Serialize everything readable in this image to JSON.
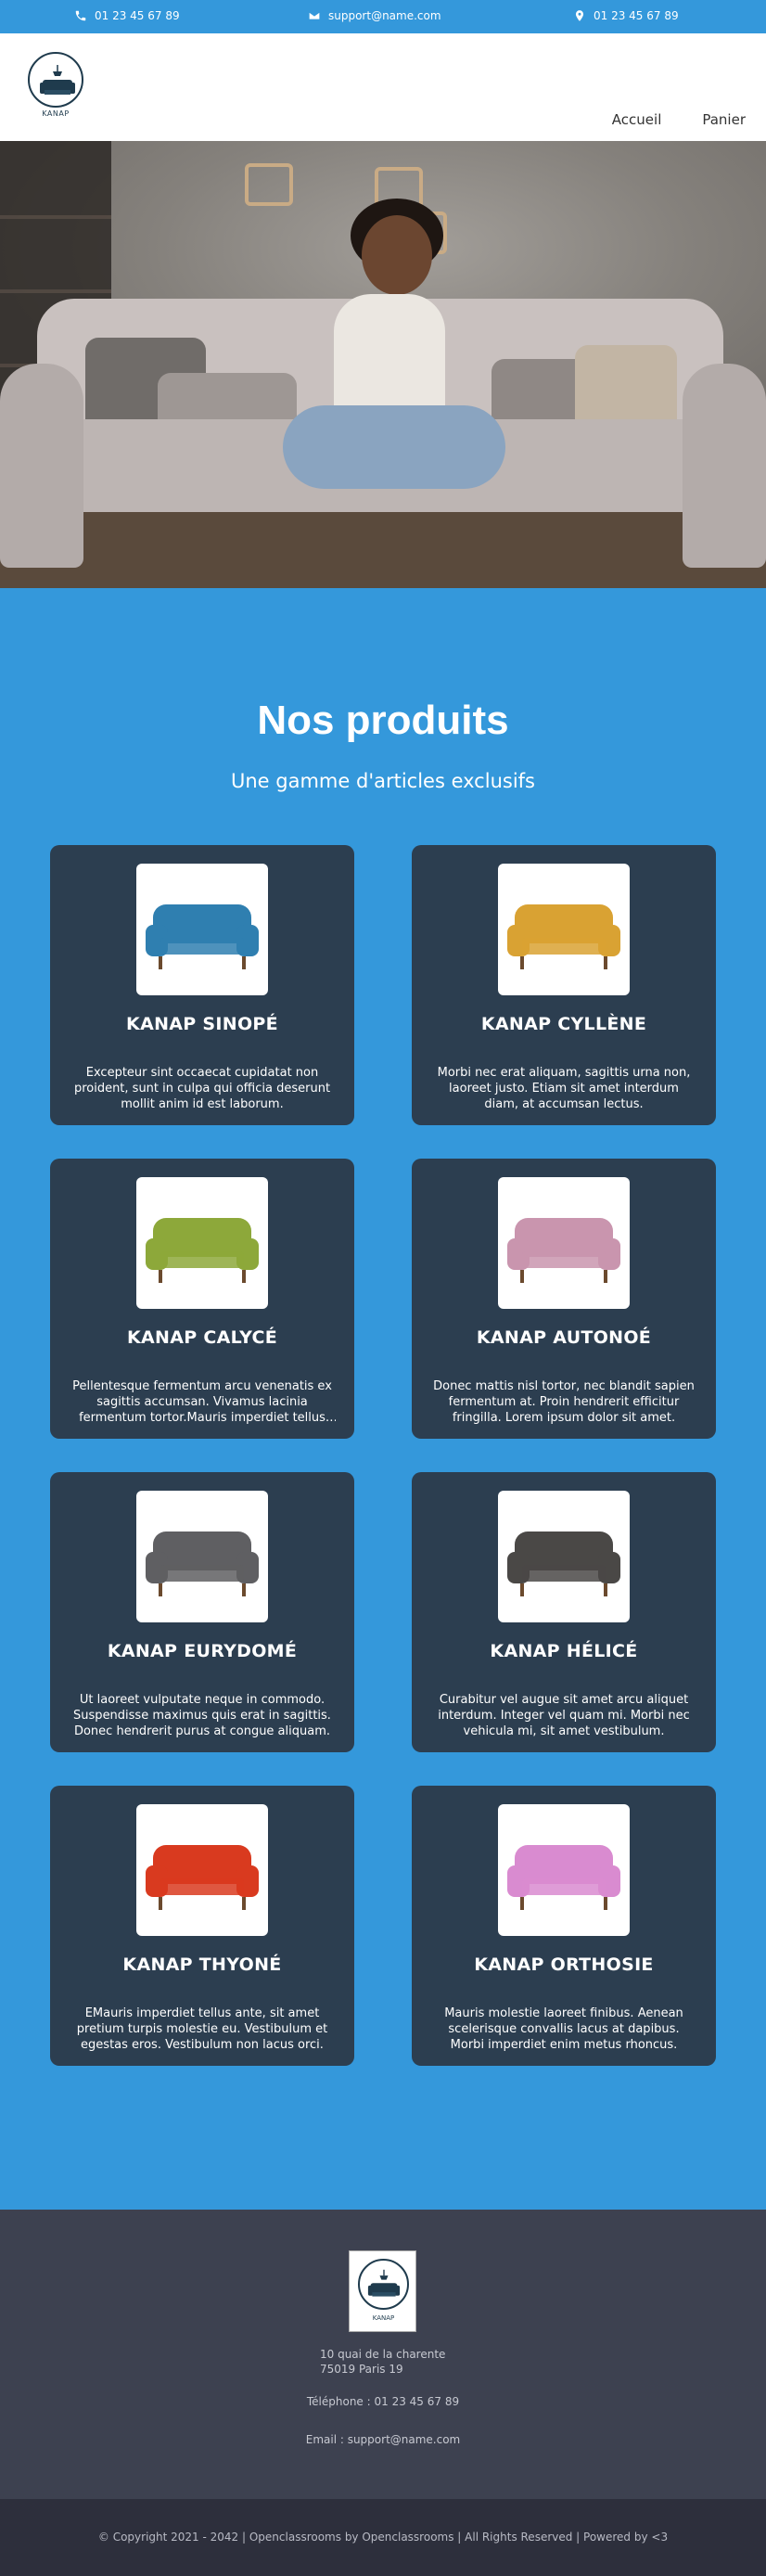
{
  "topbar": {
    "phone_1": "01 23 45 67 89",
    "email": "support@name.com",
    "phone_2": "01 23 45 67 89"
  },
  "header": {
    "logo_text": "KANAP",
    "nav": [
      {
        "label": "Accueil"
      },
      {
        "label": "Panier"
      }
    ]
  },
  "products": {
    "title": "Nos produits",
    "subtitle": "Une gamme d'articles exclusifs",
    "items": [
      {
        "name": "KANAP SINOPÉ",
        "color": "#2f7fb0",
        "description": "Excepteur sint occaecat cupidatat non proident, sunt in culpa qui officia deserunt mollit anim id est laborum."
      },
      {
        "name": "KANAP CYLLÈNE",
        "color": "#d9a233",
        "description": "Morbi nec erat aliquam, sagittis urna non, laoreet justo. Etiam sit amet interdum diam, at accumsan lectus."
      },
      {
        "name": "KANAP CALYCÉ",
        "color": "#8da83a",
        "description": "Pellentesque fermentum arcu venenatis ex sagittis accumsan. Vivamus lacinia fermentum tortor.Mauris imperdiet tellus ante."
      },
      {
        "name": "KANAP AUTONOÉ",
        "color": "#c995ae",
        "description": "Donec mattis nisl tortor, nec blandit sapien fermentum at. Proin hendrerit efficitur fringilla. Lorem ipsum dolor sit amet."
      },
      {
        "name": "KANAP EURYDOMÉ",
        "color": "#5f5f62",
        "description": "Ut laoreet vulputate neque in commodo. Suspendisse maximus quis erat in sagittis. Donec hendrerit purus at congue aliquam."
      },
      {
        "name": "KANAP HÉLICÉ",
        "color": "#4a4846",
        "description": "Curabitur vel augue sit amet arcu aliquet interdum. Integer vel quam mi. Morbi nec vehicula mi, sit amet vestibulum."
      },
      {
        "name": "KANAP THYONÉ",
        "color": "#d93a1f",
        "description": "EMauris imperdiet tellus ante, sit amet pretium turpis molestie eu. Vestibulum et egestas eros. Vestibulum non lacus orci."
      },
      {
        "name": "KANAP ORTHOSIE",
        "color": "#d98bd0",
        "description": "Mauris molestie laoreet finibus. Aenean scelerisque convallis lacus at dapibus. Morbi imperdiet enim metus rhoncus."
      }
    ]
  },
  "footer": {
    "logo_text": "KANAP",
    "address_line_1": "10 quai de la charente",
    "address_line_2": "75019 Paris 19",
    "telephone": "Téléphone : 01 23 45 67 89",
    "email": "Email : support@name.com",
    "copyright": "© Copyright 2021 - 2042 | Openclassrooms by Openclassrooms | All Rights Reserved | Powered by <3"
  }
}
